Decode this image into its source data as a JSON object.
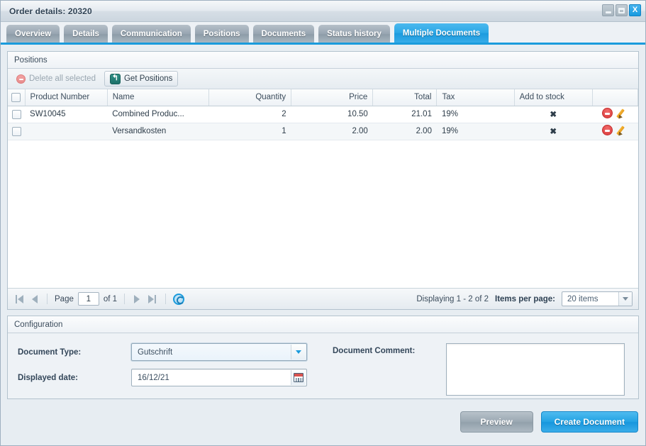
{
  "window": {
    "title": "Order details: 20320",
    "controls": {
      "minimize": "minimize",
      "maximize": "maximize",
      "close": "X"
    }
  },
  "tabs": [
    {
      "label": "Overview",
      "active": false
    },
    {
      "label": "Details",
      "active": false
    },
    {
      "label": "Communication",
      "active": false
    },
    {
      "label": "Positions",
      "active": false
    },
    {
      "label": "Documents",
      "active": false
    },
    {
      "label": "Status history",
      "active": false
    },
    {
      "label": "Multiple Documents",
      "active": true
    }
  ],
  "positions_panel": {
    "header": "Positions",
    "toolbar": {
      "delete_all": "Delete all selected",
      "get_positions": "Get Positions"
    },
    "columns": [
      "Product Number",
      "Name",
      "Quantity",
      "Price",
      "Total",
      "Tax",
      "Add to stock"
    ],
    "rows": [
      {
        "product_number": "SW10045",
        "name": "Combined Produc...",
        "quantity": "2",
        "price": "10.50",
        "total": "21.01",
        "tax": "19%",
        "add_to_stock": "✖"
      },
      {
        "product_number": "",
        "name": "Versandkosten",
        "quantity": "1",
        "price": "2.00",
        "total": "2.00",
        "tax": "19%",
        "add_to_stock": "✖"
      }
    ],
    "pager": {
      "page_label": "Page",
      "page_value": "1",
      "of_label": "of 1",
      "displaying": "Displaying 1 - 2 of 2",
      "items_per_page_label": "Items per page:",
      "items_per_page_value": "20 items"
    }
  },
  "configuration": {
    "header": "Configuration",
    "document_type_label": "Document Type:",
    "document_type_value": "Gutschrift",
    "displayed_date_label": "Displayed date:",
    "displayed_date_value": "16/12/21",
    "document_comment_label": "Document Comment:",
    "document_comment_value": ""
  },
  "footer": {
    "preview": "Preview",
    "create_document": "Create Document"
  },
  "colors": {
    "accent": "#1a9bdc",
    "tab_inactive": "#97a5b1",
    "danger": "#cc2b2b",
    "teal": "#1d7169",
    "pencil": "#e59a1c"
  }
}
